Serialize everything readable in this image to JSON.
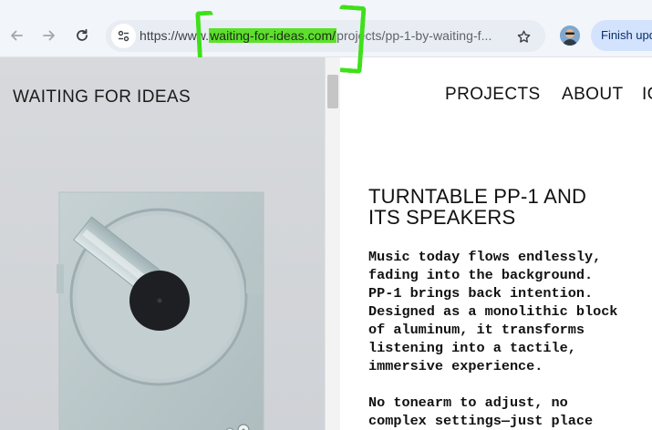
{
  "browser": {
    "url_prefix": "https://www.",
    "url_domain": "waiting-for-ideas.com/",
    "url_path": "projects/pp-1-by-waiting-f...",
    "finish_update_label": "Finish upda",
    "back_icon": "arrow-left-icon",
    "forward_icon": "arrow-right-icon",
    "reload_icon": "reload-icon",
    "highlight_color": "#5ce02b"
  },
  "site": {
    "brand": "WAITING FOR IDEAS",
    "nav": [
      {
        "label": "PROJECTS"
      },
      {
        "label": "ABOUT"
      },
      {
        "label": "IC"
      }
    ],
    "heading_lines": [
      "TURNTABLE PP-1 AND",
      "ITS SPEAKERS"
    ],
    "paragraph1_lines": [
      "Music today flows endlessly,",
      "fading into the background.",
      "PP-1 brings back intention.",
      "Designed as a monolithic block",
      "of aluminum, it transforms",
      "listening into a tactile,",
      "immersive experience."
    ],
    "paragraph2_lines": [
      "No tonearm to adjust, no",
      "complex settings—just place"
    ]
  }
}
